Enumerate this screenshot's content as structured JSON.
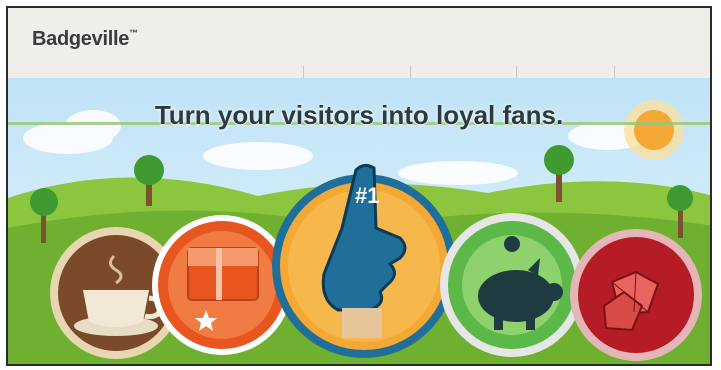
{
  "header": {
    "logo_text": "Badgeville",
    "logo_mark": "™"
  },
  "hero": {
    "headline": "Turn your visitors into loyal fans."
  },
  "badges": [
    {
      "name": "coffee-cup-icon",
      "accent": "#7a4a2b"
    },
    {
      "name": "messenger-bag-icon",
      "accent": "#e8561f"
    },
    {
      "name": "foam-finger-icon",
      "label": "#1",
      "accent": "#1f6f9a"
    },
    {
      "name": "piggy-bank-icon",
      "accent": "#5db84a"
    },
    {
      "name": "gems-icon",
      "accent": "#b51c25"
    }
  ]
}
